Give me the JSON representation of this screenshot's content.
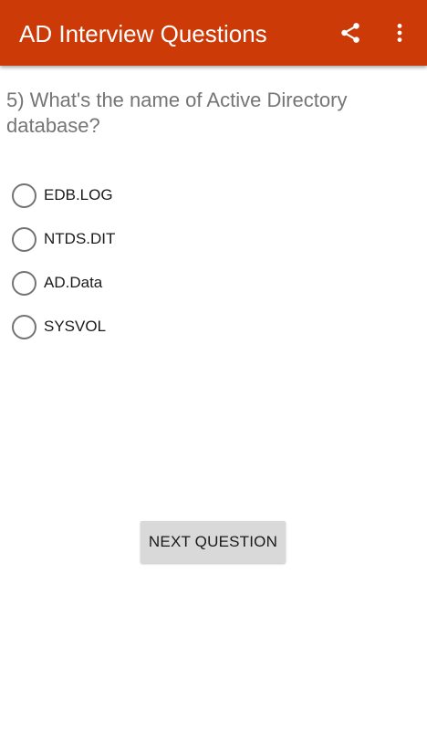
{
  "appbar": {
    "title": "AD Interview Questions",
    "background_color": "#cc3a07",
    "share_icon": "share-icon",
    "more_icon": "more-vertical-icon"
  },
  "question": {
    "text": "5) What's the name of Active Directory database?"
  },
  "options": [
    {
      "label": "EDB.LOG",
      "selected": false
    },
    {
      "label": "NTDS.DIT",
      "selected": false
    },
    {
      "label": "AD.Data",
      "selected": false
    },
    {
      "label": "SYSVOL",
      "selected": false
    }
  ],
  "next_button": {
    "label": "NEXT QUESTION"
  }
}
